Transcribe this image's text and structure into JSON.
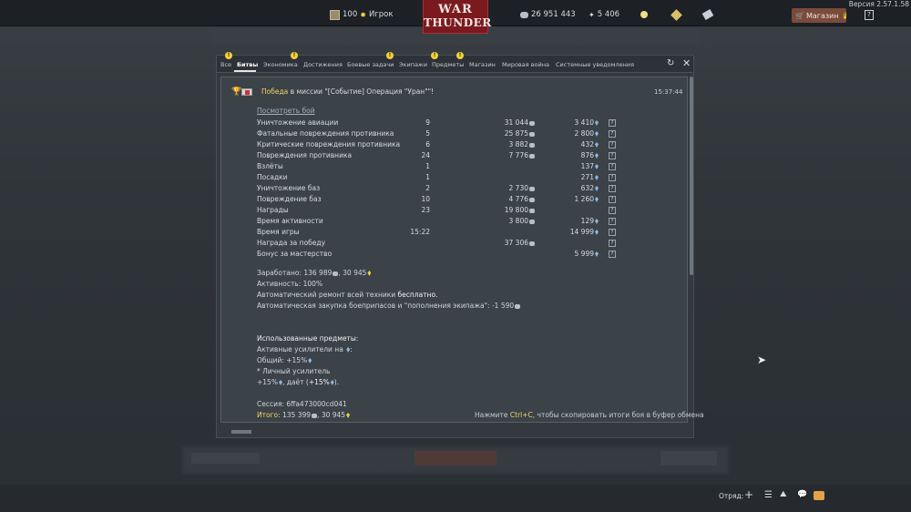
{
  "topbar": {
    "rank": "100",
    "player": "Игрок",
    "silver": "26 951 443",
    "gold": "5 406",
    "shop": "Магазин",
    "version": "Версия 2.57.1.58"
  },
  "logo": {
    "line1": "WAR",
    "line2": "THUNDER"
  },
  "tabs": [
    "Все",
    "Битвы",
    "Экономика",
    "Достижения",
    "Боевые задачи",
    "Экипажи",
    "Предметы",
    "Магазин",
    "Мировая война",
    "Системные уведомления"
  ],
  "message": {
    "win_word": "Победа",
    "title_rest": " в миссии \"[Событие] Операция \"Уран\"\"!",
    "time": "15:37:44",
    "view_battle": "Посмотреть бой",
    "rows": [
      {
        "name": "Уничтожение авиации",
        "count": "9",
        "silver": "31 044",
        "rp": "3 410"
      },
      {
        "name": "Фатальные повреждения противника",
        "count": "5",
        "silver": "25 875",
        "rp": "2 800"
      },
      {
        "name": "Критические повреждения противника",
        "count": "6",
        "silver": "3 882",
        "rp": "432"
      },
      {
        "name": "Повреждения противника",
        "count": "24",
        "silver": "7 776",
        "rp": "876"
      },
      {
        "name": "Взлёты",
        "count": "1",
        "silver": "",
        "rp": "137"
      },
      {
        "name": "Посадки",
        "count": "1",
        "silver": "",
        "rp": "271"
      },
      {
        "name": "Уничтожение баз",
        "count": "2",
        "silver": "2 730",
        "rp": "632"
      },
      {
        "name": "Повреждение баз",
        "count": "10",
        "silver": "4 776",
        "rp": "1 260"
      },
      {
        "name": "Награды",
        "count": "23",
        "silver": "19 800",
        "rp": ""
      },
      {
        "name": "Время активности",
        "count": "",
        "silver": "3 800",
        "rp": "129"
      },
      {
        "name": "Время игры",
        "count": "15:22",
        "silver": "",
        "rp": "14 999"
      },
      {
        "name": "Награда за победу",
        "count": "",
        "silver": "37 306",
        "rp": ""
      },
      {
        "name": "Бонус за мастерство",
        "count": "",
        "silver": "",
        "rp": "5 999"
      }
    ],
    "earned_label": "Заработано:",
    "earned_silver": "136 989",
    "earned_rp": "30 945",
    "activity": "Активность: 100%",
    "repair_label": "Автоматический ремонт всей техники ",
    "repair_value": "бесплатно.",
    "ammo": "Автоматическая закупка боеприпасов и \"пополнения экипажа\": -1 590",
    "used_items": "Использованные предметы:",
    "active_boosters": "Активные усилители на ",
    "general": "Общий: +15%",
    "personal": "* Личный усилитель",
    "personal_bonus_a": "+15%",
    "personal_bonus_b": ", даёт (",
    "personal_bonus_c": "+15%",
    "personal_bonus_d": ").",
    "session": "Сессия: 6ffa473000cd041",
    "total_label": "Итого: ",
    "total_silver": "135 399",
    "total_rp": "30 945",
    "copy_pre": "Нажмите ",
    "copy_key": "Ctrl+C",
    "copy_post": ", чтобы скопировать итоги боя в буфер обмена"
  },
  "bottom": {
    "squad": "Отряд:"
  }
}
